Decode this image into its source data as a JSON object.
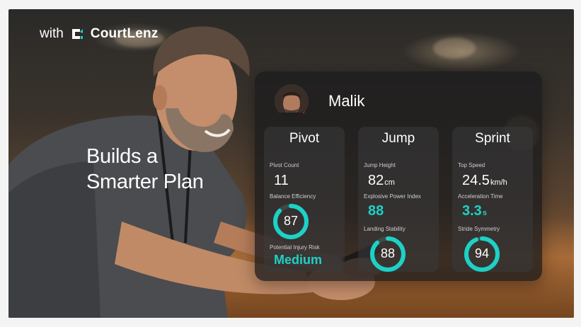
{
  "brand": {
    "with": "with",
    "name": "CourtLenz"
  },
  "headline": {
    "line1": "Builds a",
    "line2": "Smarter Plan"
  },
  "user": {
    "name": "Malik"
  },
  "colors": {
    "accent": "#1dd1c6",
    "panel": "#1c1c1e",
    "status": "#e0242a"
  },
  "cards": [
    {
      "title": "Pivot",
      "metrics": [
        {
          "label": "Pivot Count",
          "value": "11"
        },
        {
          "label": "Balance Efficiency",
          "gauge": 87
        },
        {
          "label": "Potential Injury Risk",
          "value": "Medium"
        }
      ]
    },
    {
      "title": "Jump",
      "metrics": [
        {
          "label": "Jump Height",
          "value": "82",
          "unit": "cm"
        },
        {
          "label": "Explosive Power Index",
          "value": "88"
        },
        {
          "label": "Landing Stability",
          "gauge": 88
        }
      ]
    },
    {
      "title": "Sprint",
      "metrics": [
        {
          "label": "Top Speed",
          "value": "24.5",
          "unit": "km/h"
        },
        {
          "label": "Acceleration Time",
          "value": "3.3",
          "unit": "s"
        },
        {
          "label": "Stride Symmetry",
          "gauge": 94
        }
      ]
    }
  ]
}
